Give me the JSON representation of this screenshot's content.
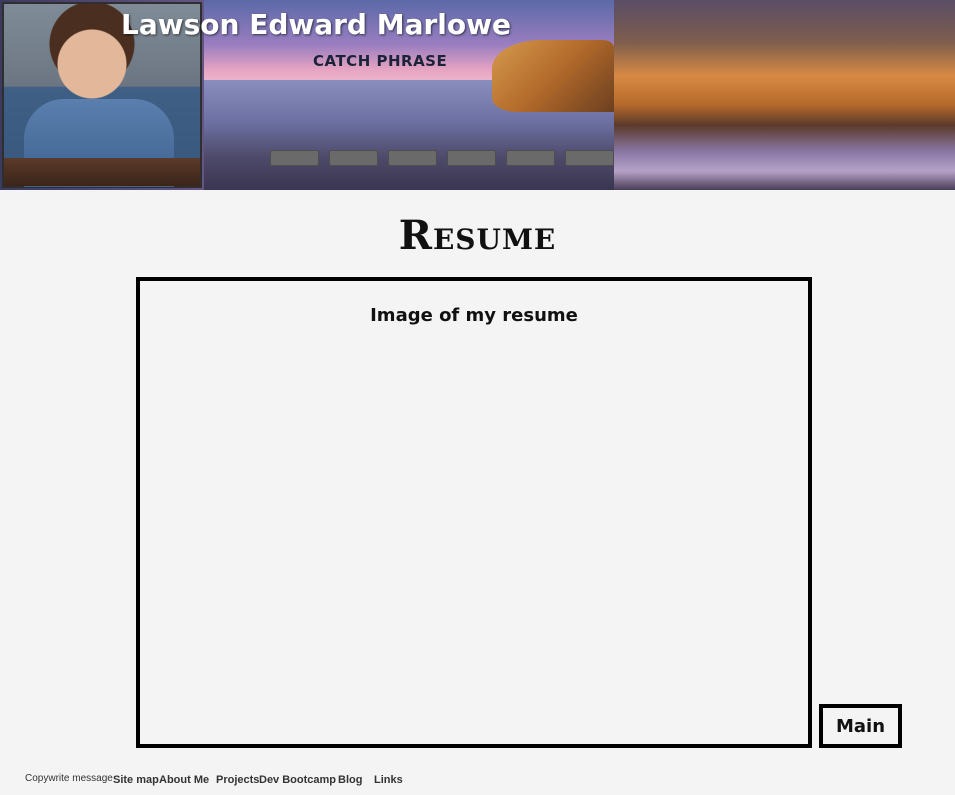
{
  "header": {
    "name": "Lawson Edward Marlowe",
    "catch_phrase": "CATCH PHRASE",
    "nav_buttons": [
      "",
      "",
      "",
      "",
      "",
      ""
    ]
  },
  "main": {
    "title": "Resume",
    "resume_caption": "Image of my resume",
    "main_button": "Main"
  },
  "footer": {
    "copyright": "Copywrite message",
    "links": [
      "Site map",
      "About Me",
      "Projects",
      "Dev Bootcamp",
      "Blog",
      "Links"
    ]
  },
  "colors": {
    "background": "#f4f4f4",
    "nav_button": "#6a6a6a",
    "box_border": "#000000"
  },
  "icons": [
    "profile-photo"
  ]
}
